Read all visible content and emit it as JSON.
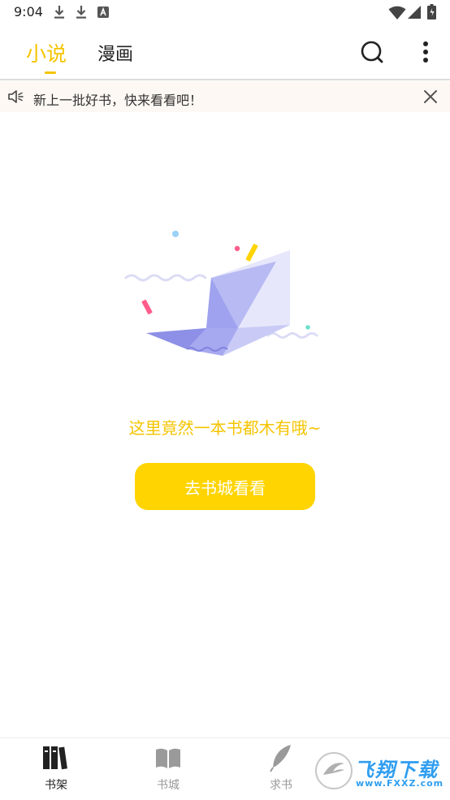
{
  "status_bar": {
    "time": "9:04",
    "left_icons": [
      "download-icon",
      "download-icon",
      "app-notification-icon"
    ],
    "right_icons": [
      "wifi-icon",
      "signal-icon",
      "battery-icon"
    ]
  },
  "header": {
    "tabs": [
      {
        "label": "小说",
        "active": true
      },
      {
        "label": "漫画",
        "active": false
      }
    ],
    "actions": [
      "search-icon",
      "more-vertical-icon"
    ],
    "accent_color": "#f5c400"
  },
  "notice": {
    "text": "新上一批好书，快来看看吧！",
    "icon": "speaker-icon",
    "close_icon": "close-icon"
  },
  "empty_state": {
    "illustration": "paper-boat-illustration",
    "message": "这里竟然一本书都木有哦~",
    "button_label": "去书城看看",
    "button_color": "#ffd400"
  },
  "bottom_nav": {
    "items": [
      {
        "label": "书架",
        "icon": "bookshelf-icon",
        "active": true
      },
      {
        "label": "书城",
        "icon": "open-book-icon",
        "active": false
      },
      {
        "label": "求书",
        "icon": "feather-icon",
        "active": false
      }
    ]
  },
  "watermark": {
    "text": "飞翔下载",
    "url": "www.FXXZ.com"
  }
}
